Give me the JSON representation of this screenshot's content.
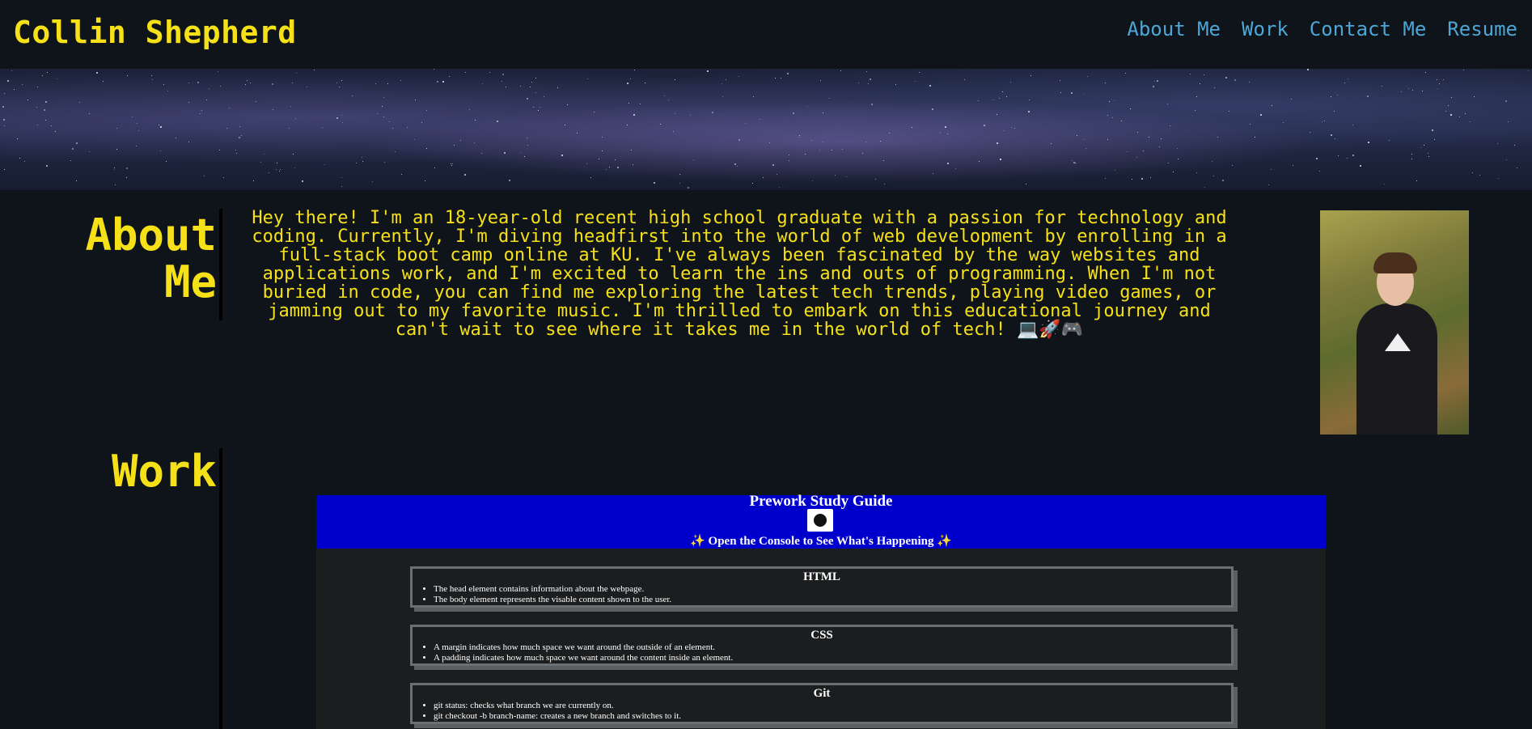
{
  "header": {
    "brand": "Collin Shepherd",
    "nav": [
      {
        "label": "About Me"
      },
      {
        "label": "Work"
      },
      {
        "label": "Contact Me"
      },
      {
        "label": "Resume"
      }
    ]
  },
  "about": {
    "title_line1": "About",
    "title_line2": "Me",
    "text": "Hey there! I'm an 18-year-old recent high school graduate with a passion for technology and coding. Currently, I'm diving headfirst into the world of web development by enrolling in a full-stack boot camp online at KU. I've always been fascinated by the way websites and applications work, and I'm excited to learn the ins and outs of programming. When I'm not buried in code, you can find me exploring the latest tech trends, playing video games, or jamming out to my favorite music. I'm thrilled to embark on this educational journey and can't wait to see where it takes me in the world of tech! 💻🚀🎮"
  },
  "work": {
    "title": "Work",
    "project": {
      "title": "Prework Study Guide",
      "console_note": "✨ Open the Console to See What's Happening ✨",
      "cards": [
        {
          "heading": "HTML",
          "items": [
            "The head element contains information about the webpage.",
            "The body element represents the visable content shown to the user."
          ]
        },
        {
          "heading": "CSS",
          "items": [
            "A margin indicates how much space we want around the outside of an element.",
            "A padding indicates how much space we want around the content inside an element."
          ]
        },
        {
          "heading": "Git",
          "items": [
            "git status: checks what branch we are currently on.",
            "git checkout -b branch-name: creates a new branch and switches to it."
          ]
        }
      ]
    }
  },
  "colors": {
    "background": "#0e1419",
    "accent_yellow": "#f6e118",
    "nav_blue": "#4da6d6",
    "project_header_blue": "#0000cc"
  }
}
